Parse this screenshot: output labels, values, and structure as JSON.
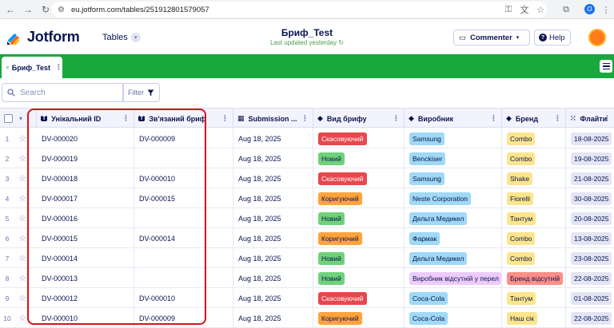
{
  "browser": {
    "url": "eu.jotform.com/tables/251912801579057",
    "profile_initial": "O"
  },
  "header": {
    "logo_text": "Jotform",
    "tables_label": "Tables",
    "title": "Бриф_Test",
    "subtitle": "Last updated yesterday",
    "commenter_label": "Commenter",
    "help_label": "Help"
  },
  "tabs": [
    {
      "label": "Бриф_Test"
    }
  ],
  "toolbar": {
    "search_placeholder": "Search",
    "filter_label": "Filter"
  },
  "columns": [
    {
      "label": "Унікальний ID",
      "icon": "text-type-icon"
    },
    {
      "label": "Зв'язаний бриф",
      "icon": "text-type-icon"
    },
    {
      "label": "Submission ...",
      "icon": "calendar-icon"
    },
    {
      "label": "Вид брифу",
      "icon": "tag-icon"
    },
    {
      "label": "Виробник",
      "icon": "tag-icon"
    },
    {
      "label": "Бренд",
      "icon": "tag-icon"
    },
    {
      "label": "Флайти",
      "icon": "grid-icon"
    }
  ],
  "colors": {
    "green_bar": "#18a83d",
    "red_pill": "#e5484d",
    "green_pill": "#6fd27a",
    "orange_pill": "#ffa33a",
    "blue_pill": "#9fd9f5",
    "yellow_pill": "#fde58c",
    "purple_pill": "#eccbfb",
    "pink_pill": "#fb8f87",
    "annotation": "#d9121a"
  },
  "rows": [
    {
      "num": "1",
      "id": "DV-000020",
      "linked": "DV-000009",
      "date": "Aug 18, 2025",
      "type": "Скасовуючий",
      "maker": "Samsung",
      "brand": "Combo",
      "flight": "18-08-2025"
    },
    {
      "num": "2",
      "id": "DV-000019",
      "linked": "",
      "date": "Aug 18, 2025",
      "type": "Новий",
      "maker": "Benckiser",
      "brand": "Combo",
      "flight": "19-08-2025"
    },
    {
      "num": "3",
      "id": "DV-000018",
      "linked": "DV-000010",
      "date": "Aug 18, 2025",
      "type": "Скасовуючий",
      "maker": "Samsung",
      "brand": "Shake",
      "flight": "21-08-2025"
    },
    {
      "num": "4",
      "id": "DV-000017",
      "linked": "DV-000015",
      "date": "Aug 18, 2025",
      "type": "Коригуючий",
      "maker": "Neste Corporation",
      "brand": "Fiorelli",
      "flight": "30-08-2025"
    },
    {
      "num": "5",
      "id": "DV-000016",
      "linked": "",
      "date": "Aug 18, 2025",
      "type": "Новий",
      "maker": "Дельта Медикел",
      "brand": "Тантум",
      "flight": "20-08-2025"
    },
    {
      "num": "6",
      "id": "DV-000015",
      "linked": "DV-000014",
      "date": "Aug 18, 2025",
      "type": "Коригуючий",
      "maker": "Фармак",
      "brand": "Combo",
      "flight": "13-08-2025"
    },
    {
      "num": "7",
      "id": "DV-000014",
      "linked": "",
      "date": "Aug 18, 2025",
      "type": "Новий",
      "maker": "Дельта Медикел",
      "brand": "Combo",
      "flight": "23-08-2025"
    },
    {
      "num": "8",
      "id": "DV-000013",
      "linked": "",
      "date": "Aug 18, 2025",
      "type": "Новий",
      "maker": "Виробник відсутній у перел",
      "brand": "Бренд відсутній",
      "flight": "22-08-2025"
    },
    {
      "num": "9",
      "id": "DV-000012",
      "linked": "DV-000010",
      "date": "Aug 18, 2025",
      "type": "Скасовуючий",
      "maker": "Coca-Cola",
      "brand": "Тантум",
      "flight": "01-08-2025"
    },
    {
      "num": "10",
      "id": "DV-000010",
      "linked": "DV-000009",
      "date": "Aug 18, 2025",
      "type": "Коригуючий",
      "maker": "Coca-Cola",
      "brand": "Наш сік",
      "flight": "22-08-2025"
    }
  ]
}
